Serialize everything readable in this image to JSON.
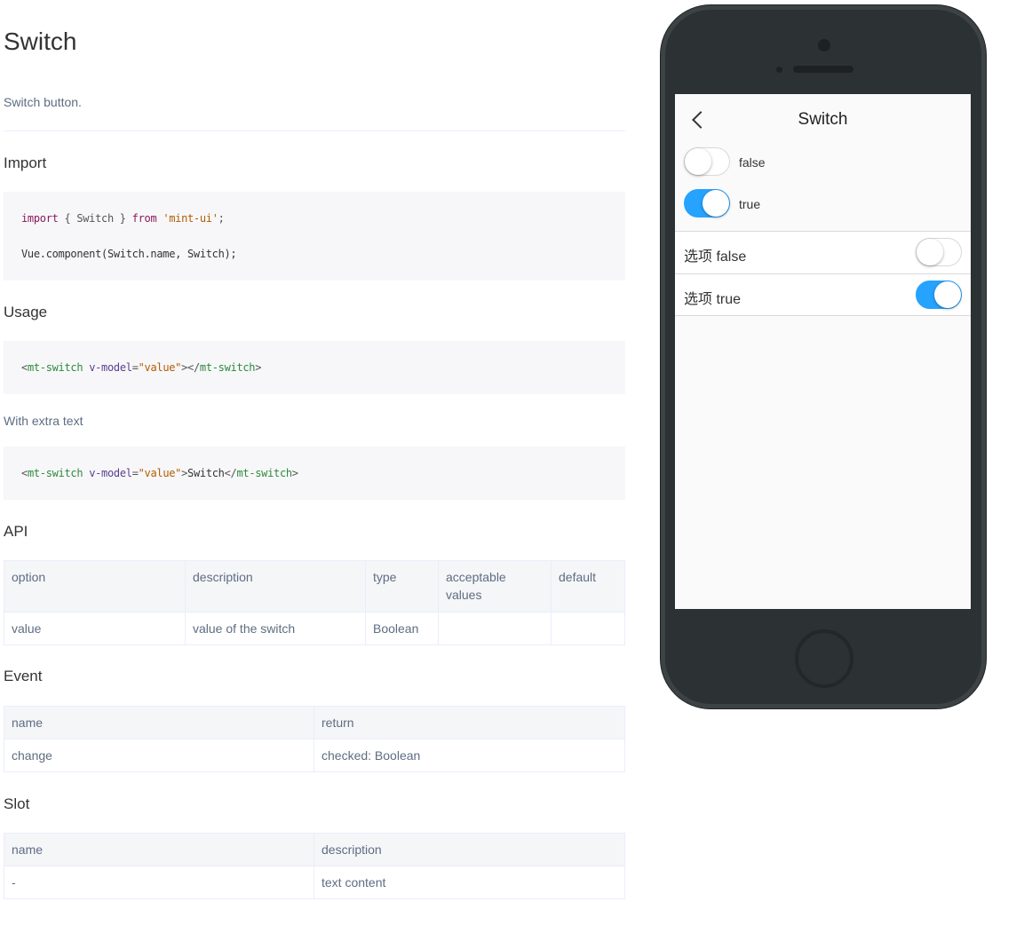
{
  "doc": {
    "title": "Switch",
    "intro": "Switch button.",
    "import_heading": "Import",
    "import_code": {
      "line1": {
        "kw1": "import",
        "mid": " { Switch } ",
        "kw2": "from",
        "sp": " ",
        "str": "'mint-ui'",
        "end": ";"
      },
      "line2": "Vue.component(Switch.name, Switch);"
    },
    "usage_heading": "Usage",
    "usage_code": {
      "open_lt": "<",
      "tag": "mt-switch",
      "sp": " ",
      "attr": "v-model",
      "eq": "=",
      "val": "\"value\"",
      "gt": ">",
      "close_lt": "</",
      "close_tag": "mt-switch",
      "close_gt": ">"
    },
    "extra_text": "With extra text",
    "extra_code": {
      "open_lt": "<",
      "tag": "mt-switch",
      "sp": " ",
      "attr": "v-model",
      "eq": "=",
      "val": "\"value\"",
      "gt": ">",
      "inner": "Switch",
      "close_lt": "</",
      "close_tag": "mt-switch",
      "close_gt": ">"
    },
    "api_heading": "API",
    "api_table": {
      "headers": [
        "option",
        "description",
        "type",
        "acceptable values",
        "default"
      ],
      "rows": [
        [
          "value",
          "value of the switch",
          "Boolean",
          "",
          ""
        ]
      ]
    },
    "event_heading": "Event",
    "event_table": {
      "headers": [
        "name",
        "return"
      ],
      "rows": [
        [
          "change",
          "checked: Boolean"
        ]
      ]
    },
    "slot_heading": "Slot",
    "slot_table": {
      "headers": [
        "name",
        "description"
      ],
      "rows": [
        [
          "-",
          "text content"
        ]
      ]
    }
  },
  "phone": {
    "nav_title": "Switch",
    "switches": [
      {
        "label": "false",
        "on": false
      },
      {
        "label": "true",
        "on": true
      }
    ],
    "cells": [
      {
        "label": "选项 false",
        "on": false
      },
      {
        "label": "选项 true",
        "on": true
      }
    ],
    "accent_color": "#26a2ff"
  }
}
